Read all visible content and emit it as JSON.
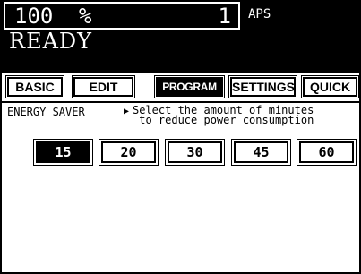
{
  "status": {
    "zoom_value": "100",
    "zoom_unit": "%",
    "copy_count": "1",
    "paper_mode": "APS",
    "message": "READY"
  },
  "tabs": [
    {
      "label": "BASIC",
      "active": false
    },
    {
      "label": "EDIT",
      "active": false
    },
    {
      "label": "PROGRAM",
      "active": true
    },
    {
      "label": "SETTINGS",
      "active": false
    },
    {
      "label": "QUICK",
      "active": false
    }
  ],
  "energy_saver": {
    "label": "ENERGY SAVER",
    "arrow": "▶",
    "instruction": "Select the amount of minutes\n to reduce power consumption",
    "options": [
      {
        "label": "15",
        "selected": true
      },
      {
        "label": "20",
        "selected": false
      },
      {
        "label": "30",
        "selected": false
      },
      {
        "label": "45",
        "selected": false
      },
      {
        "label": "60",
        "selected": false
      }
    ]
  }
}
